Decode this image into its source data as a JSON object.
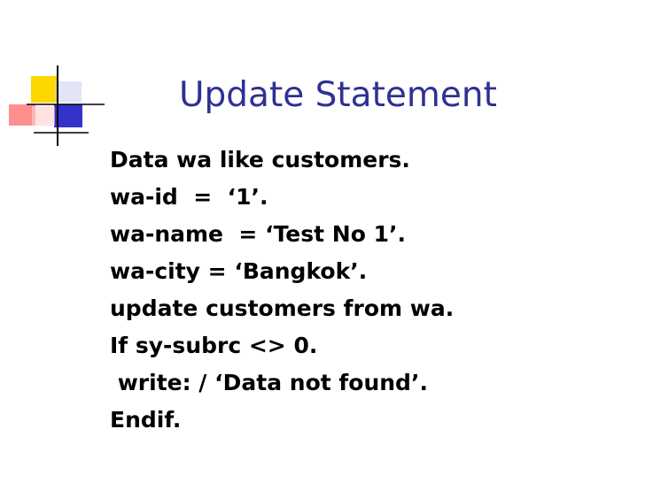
{
  "slide": {
    "title": "Update Statement",
    "title_color": "#2e3192",
    "lines": [
      "Data wa like customers.",
      "wa-id  =  ‘1’.",
      "wa-name  = ‘Test No 1’.",
      "wa-city = ‘Bangkok’.",
      "update customers from wa.",
      "If sy-subrc <> 0.",
      " write: / ‘Data not found’.",
      "Endif."
    ]
  },
  "decoration": {
    "square_colors": [
      "#ffd700",
      "#ff6b6b",
      "#3333cc"
    ],
    "line_color": "#000000"
  }
}
